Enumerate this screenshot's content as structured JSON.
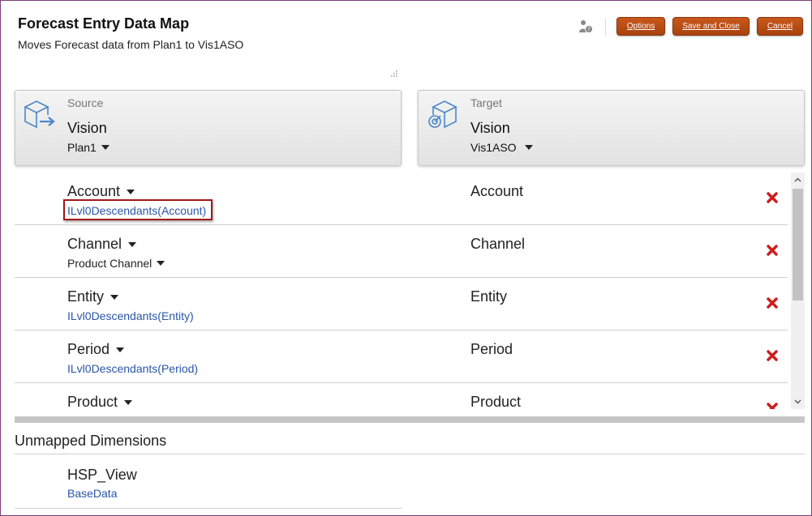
{
  "header": {
    "title": "Forecast Entry Data Map",
    "subtitle": "Moves Forecast data from Plan1 to Vis1ASO"
  },
  "toolbar": {
    "options_label": "Options",
    "save_close_label": "Save and Close",
    "cancel_label": "Cancel",
    "user_icon": "user-help-icon"
  },
  "source": {
    "label": "Source",
    "app": "Vision",
    "cube": "Plan1",
    "icon": "cube-export-icon"
  },
  "target": {
    "label": "Target",
    "app": "Vision",
    "cube": "Vis1ASO",
    "icon": "cube-target-icon"
  },
  "mappings": [
    {
      "source_dim": "Account",
      "source_member": "ILvl0Descendants(Account)",
      "target_dim": "Account",
      "highlighted": true
    },
    {
      "source_dim": "Channel",
      "source_member": "Product Channel",
      "target_dim": "Channel",
      "member_dropdown": true
    },
    {
      "source_dim": "Entity",
      "source_member": "ILvl0Descendants(Entity)",
      "target_dim": "Entity"
    },
    {
      "source_dim": "Period",
      "source_member": "ILvl0Descendants(Period)",
      "target_dim": "Period"
    },
    {
      "source_dim": "Product",
      "source_member": "",
      "target_dim": "Product"
    }
  ],
  "unmapped": {
    "title": "Unmapped Dimensions",
    "items": [
      {
        "dim": "HSP_View",
        "member": "BaseData"
      }
    ]
  },
  "colors": {
    "button": "#b84b14",
    "link": "#2a55a8",
    "delete": "#cc1f1f",
    "highlight_border": "#a01818"
  }
}
